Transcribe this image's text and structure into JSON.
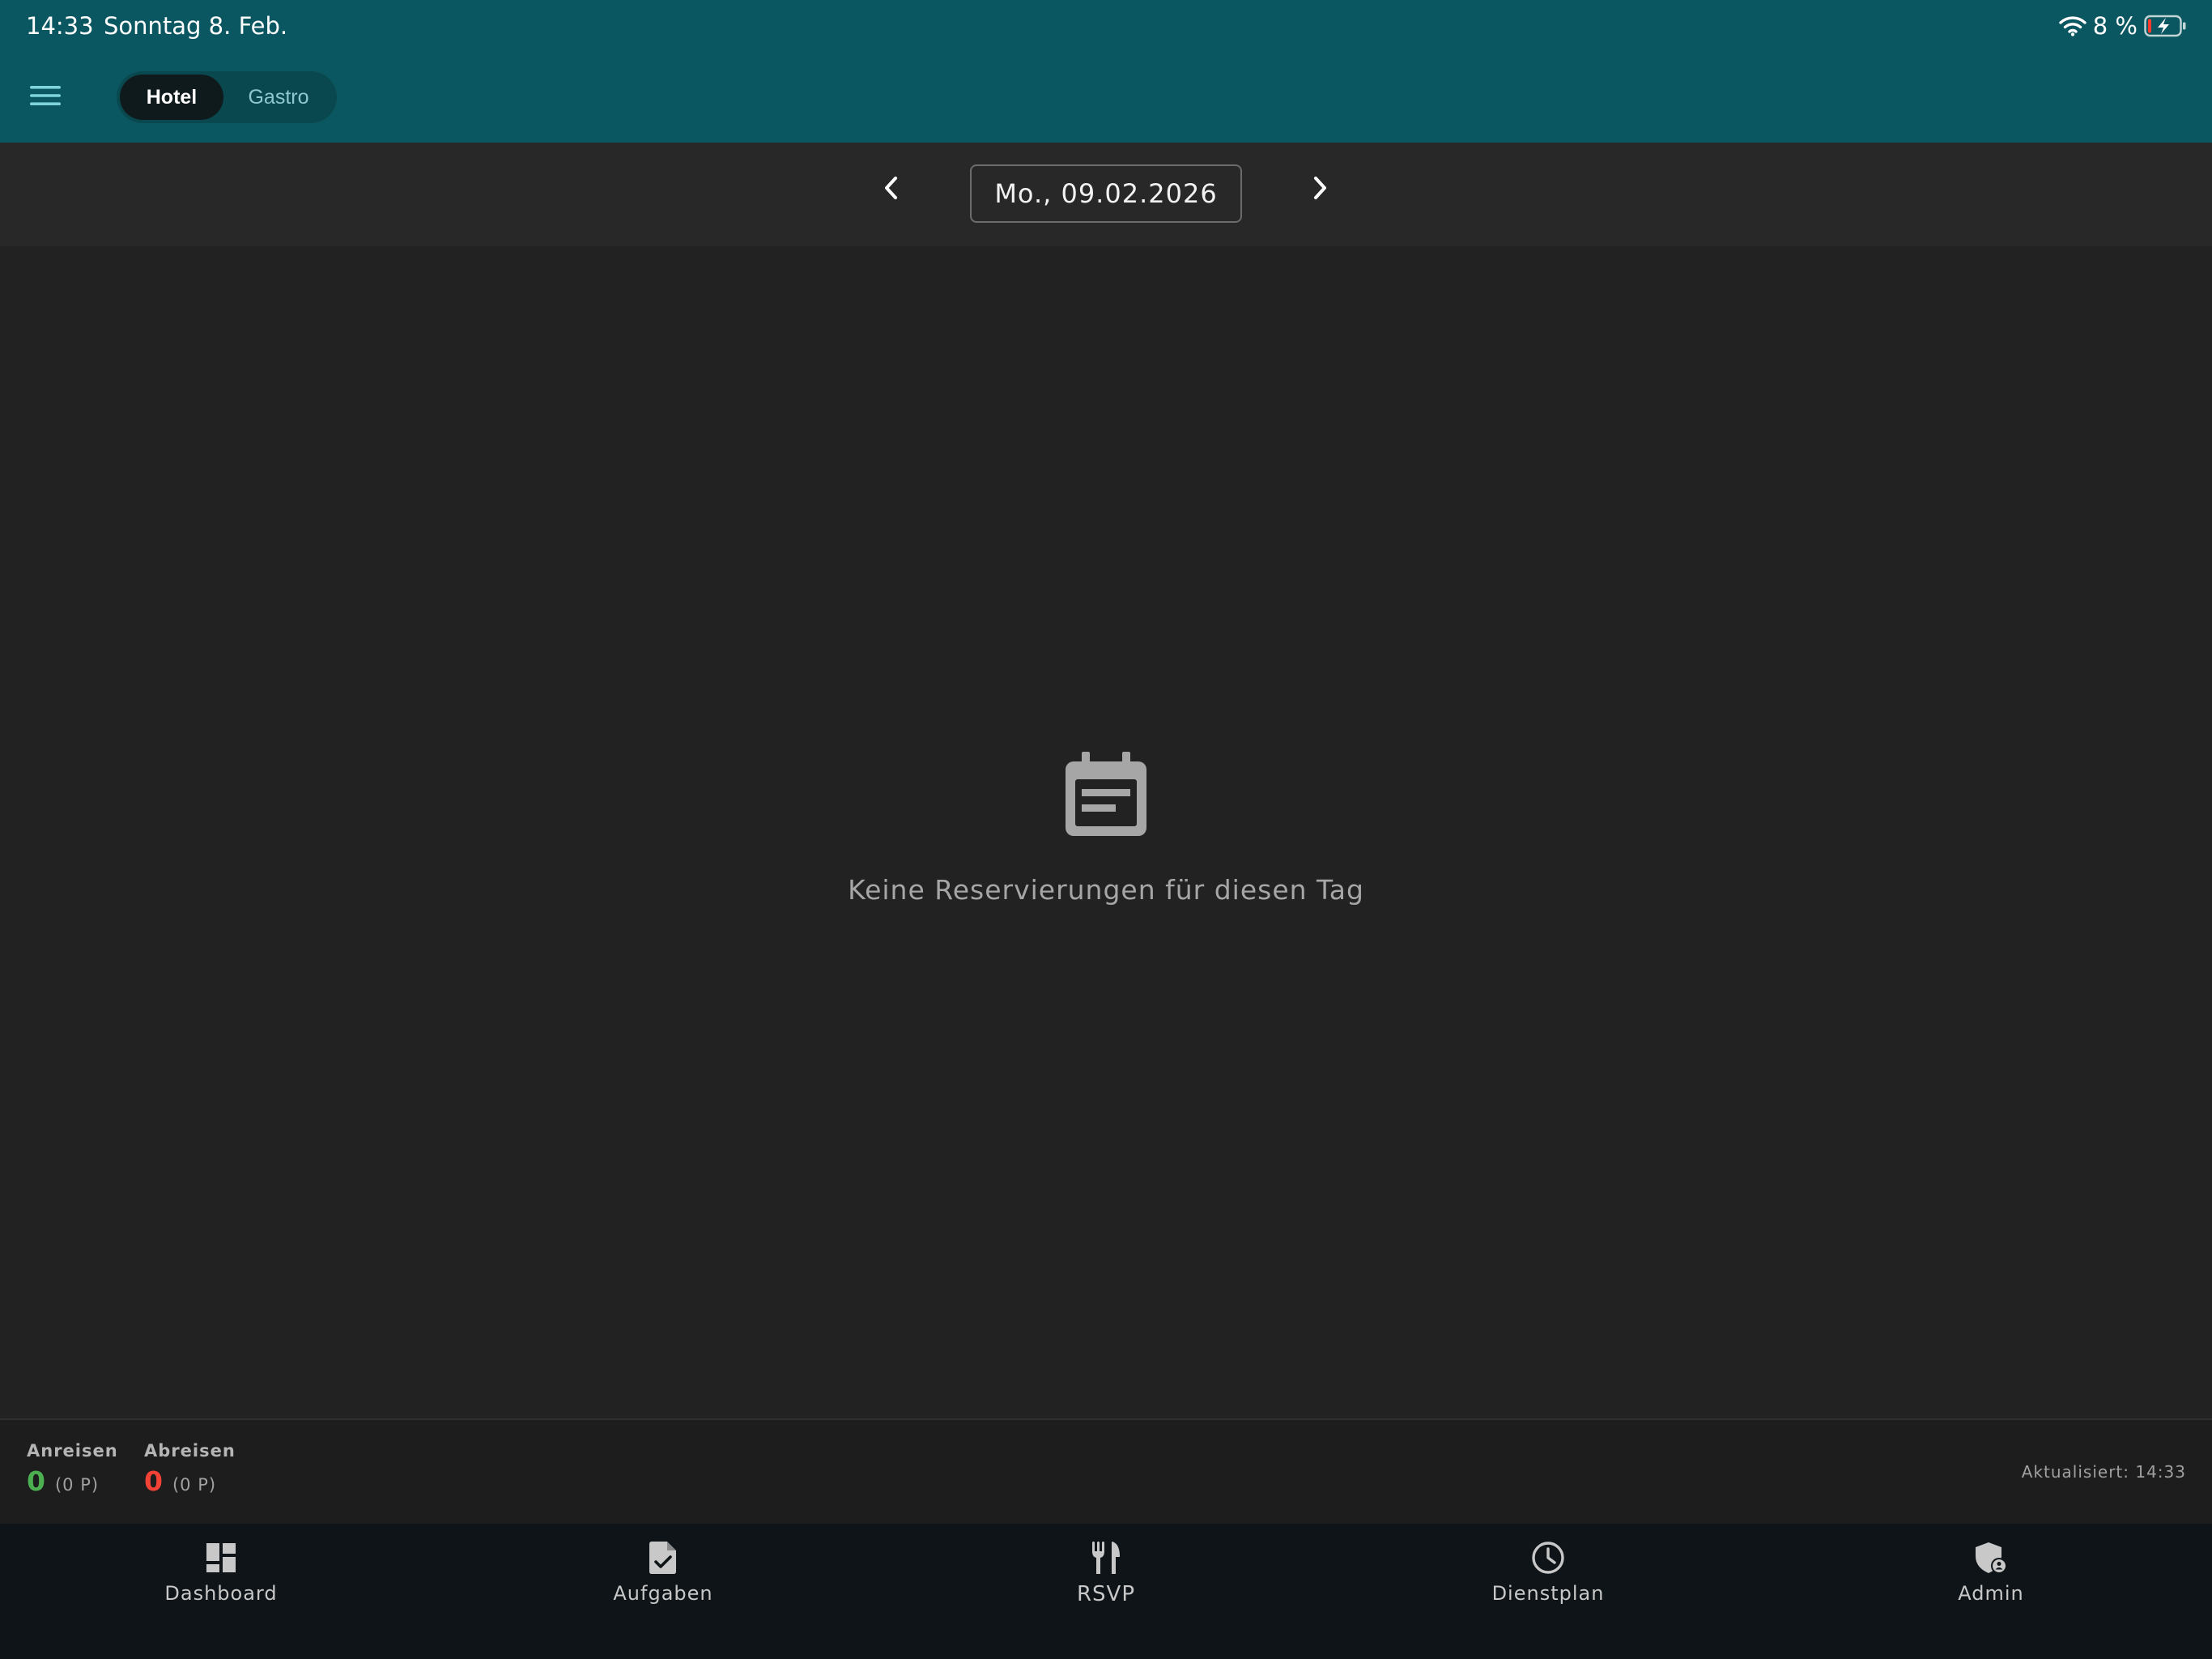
{
  "status_bar": {
    "time": "14:33",
    "date": "Sonntag 8. Feb.",
    "battery": "8 %"
  },
  "app_bar": {
    "menu_icon": "hamburger-menu-icon",
    "segments": [
      {
        "label": "Hotel",
        "active": true
      },
      {
        "label": "Gastro",
        "active": false
      }
    ]
  },
  "date_nav": {
    "current_date": "Mo., 09.02.2026",
    "prev_icon": "chevron-left-icon",
    "next_icon": "chevron-right-icon"
  },
  "empty_state": {
    "icon": "calendar-note-icon",
    "message": "Keine Reservierungen für diesen Tag"
  },
  "summary": {
    "arrivals": {
      "label": "Anreisen",
      "value": "0",
      "persons": "(0 P)",
      "color": "#4caf50"
    },
    "departures": {
      "label": "Abreisen",
      "value": "0",
      "persons": "(0 P)",
      "color": "#f44336"
    },
    "updated": "Aktualisiert: 14:33"
  },
  "bottom_nav": {
    "items": [
      {
        "label": "Dashboard",
        "icon": "dashboard-icon"
      },
      {
        "label": "Aufgaben",
        "icon": "task-document-icon"
      },
      {
        "label": "RSVP",
        "icon": "fork-knife-icon"
      },
      {
        "label": "Dienstplan",
        "icon": "clock-icon"
      },
      {
        "label": "Admin",
        "icon": "admin-shield-icon"
      }
    ]
  },
  "colors": {
    "header_bg": "#0b5761",
    "page_bg": "#222222",
    "nav_bg": "#0e1417"
  }
}
